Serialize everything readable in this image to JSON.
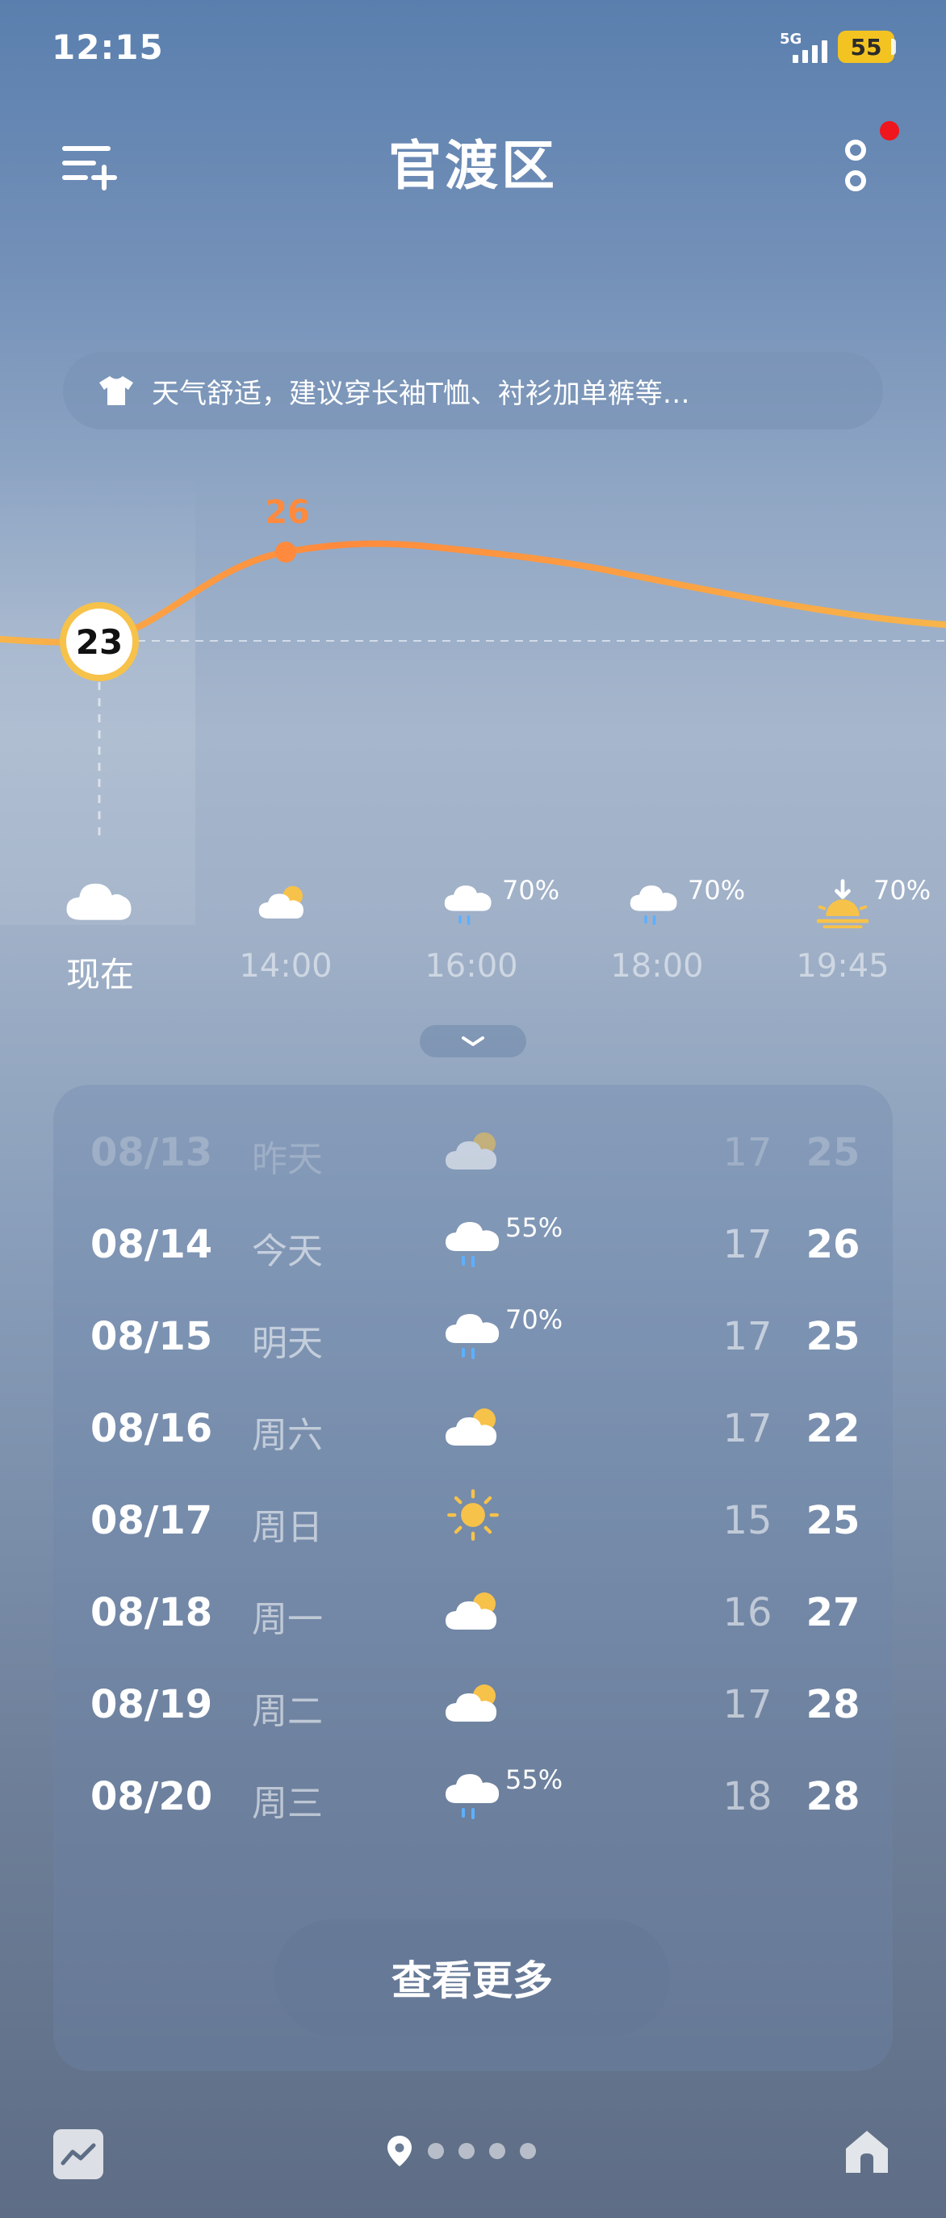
{
  "status_bar": {
    "time": "12:15",
    "network": "5G",
    "battery": "55"
  },
  "header": {
    "title": "官渡区"
  },
  "tip": {
    "text": "天气舒适，建议穿长袖T恤、衬衫加单裤等…",
    "icon": "tshirt-icon"
  },
  "hourly": {
    "current_temp": "23",
    "peak_temp": "26",
    "items": [
      {
        "label": "现在",
        "icon": "cloudy-icon",
        "precip": ""
      },
      {
        "label": "14:00",
        "icon": "partly-cloudy-icon",
        "precip": ""
      },
      {
        "label": "16:00",
        "icon": "rain-icon",
        "precip": "70%"
      },
      {
        "label": "18:00",
        "icon": "rain-icon",
        "precip": "70%"
      },
      {
        "label": "19:45",
        "icon": "sunset-icon",
        "precip": "70%"
      }
    ]
  },
  "daily": [
    {
      "date": "08/13",
      "day": "昨天",
      "icon": "partly-cloudy-icon",
      "precip": "",
      "low": "17",
      "high": "25"
    },
    {
      "date": "08/14",
      "day": "今天",
      "icon": "rain-icon",
      "precip": "55%",
      "low": "17",
      "high": "26"
    },
    {
      "date": "08/15",
      "day": "明天",
      "icon": "rain-icon",
      "precip": "70%",
      "low": "17",
      "high": "25"
    },
    {
      "date": "08/16",
      "day": "周六",
      "icon": "partly-cloudy-icon",
      "precip": "",
      "low": "17",
      "high": "22"
    },
    {
      "date": "08/17",
      "day": "周日",
      "icon": "sunny-icon",
      "precip": "",
      "low": "15",
      "high": "25"
    },
    {
      "date": "08/18",
      "day": "周一",
      "icon": "partly-cloudy-icon",
      "precip": "",
      "low": "16",
      "high": "27"
    },
    {
      "date": "08/19",
      "day": "周二",
      "icon": "partly-cloudy-icon",
      "precip": "",
      "low": "17",
      "high": "28"
    },
    {
      "date": "08/20",
      "day": "周三",
      "icon": "rain-icon",
      "precip": "55%",
      "low": "18",
      "high": "28"
    }
  ],
  "see_more_label": "查看更多",
  "colors": {
    "accent_orange": "#ff8a3d",
    "sun_yellow": "#f7c24a",
    "notification_red": "#f0161d",
    "battery_yellow": "#f3c321"
  }
}
